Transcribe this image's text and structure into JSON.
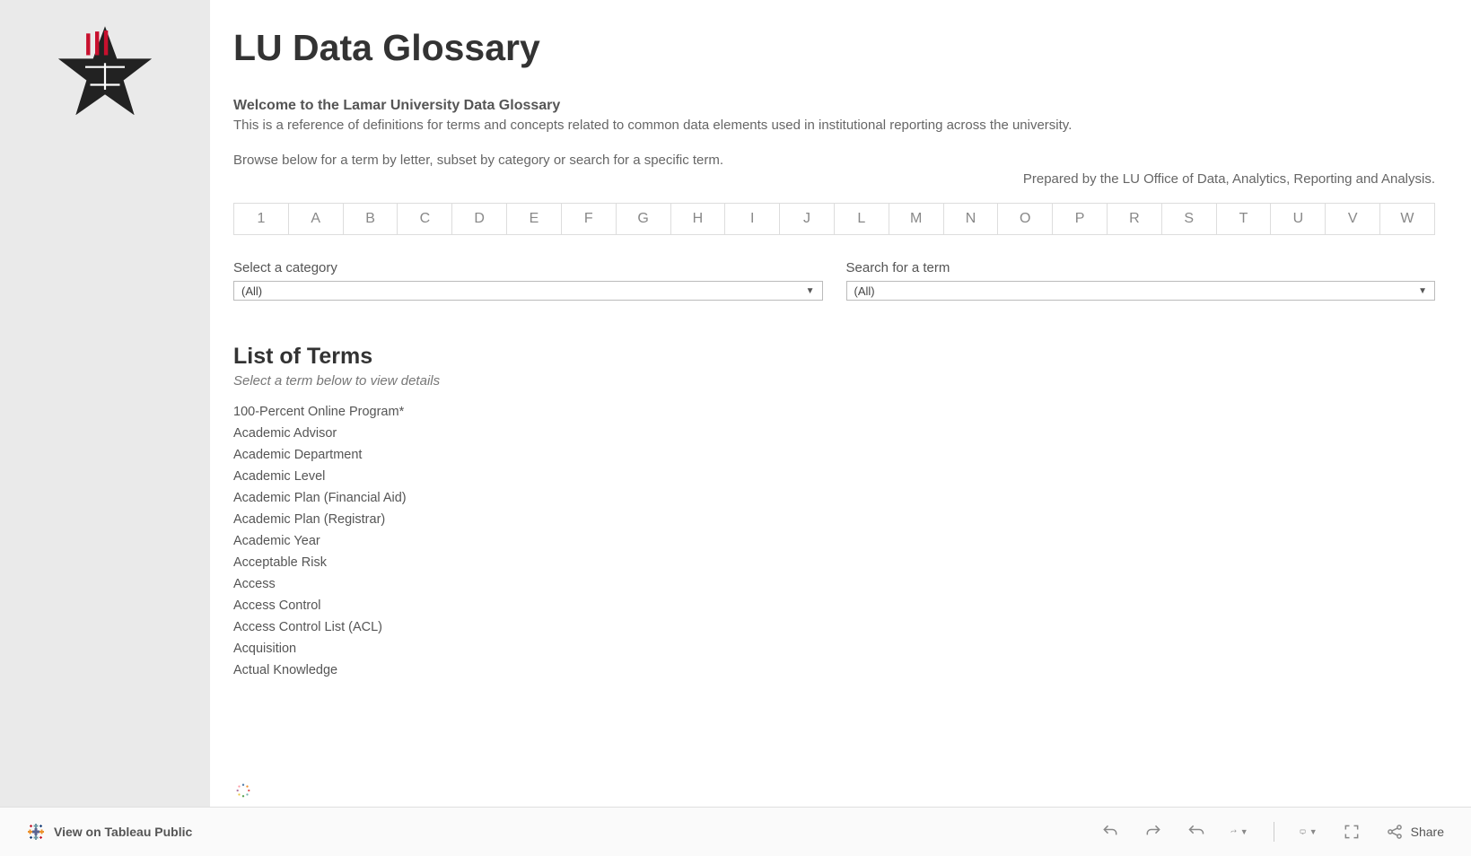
{
  "header": {
    "title": "LU Data Glossary",
    "welcome": "Welcome to the Lamar University Data Glossary",
    "description": "This is a reference of definitions for terms and concepts related to common data elements used in institutional reporting across the university.",
    "browse": "Browse below for a term by letter, subset by category or search for a specific term.",
    "prepared_by": "Prepared by the LU Office of Data, Analytics, Reporting and Analysis."
  },
  "letters": [
    "1",
    "A",
    "B",
    "C",
    "D",
    "E",
    "F",
    "G",
    "H",
    "I",
    "J",
    "L",
    "M",
    "N",
    "O",
    "P",
    "R",
    "S",
    "T",
    "U",
    "V",
    "W"
  ],
  "filters": {
    "category": {
      "label": "Select a category",
      "value": "(All)"
    },
    "search": {
      "label": "Search for a term",
      "value": "(All)"
    }
  },
  "terms_section": {
    "title": "List of Terms",
    "subtitle": "Select a term below to view details"
  },
  "terms": [
    "100-Percent Online Program*",
    "Academic Advisor",
    "Academic Department",
    "Academic Level",
    "Academic Plan (Financial Aid)",
    "Academic Plan (Registrar)",
    "Academic Year",
    "Acceptable Risk",
    "Access",
    "Access Control",
    "Access Control List (ACL)",
    "Acquisition",
    "Actual Knowledge"
  ],
  "footer": {
    "view_on": "View on Tableau Public",
    "share": "Share"
  }
}
